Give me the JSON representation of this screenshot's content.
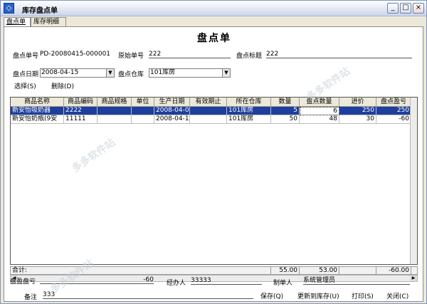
{
  "window": {
    "title": "库存盘点单",
    "icon_label": "◇"
  },
  "tabs": [
    "盘点单",
    "库存明细"
  ],
  "form": {
    "heading": "盘点单",
    "bill_no_label": "盘点单号",
    "bill_no": "PD-20080415-000001",
    "orig_no_label": "原始单号",
    "orig_no": "222",
    "title_label": "盘点标题",
    "title_value": "222",
    "date_label": "盘点日期",
    "date_value": "2008-04-15",
    "warehouse_label": "盘点仓库",
    "warehouse_value": "101库房",
    "select_label": "选择(S)",
    "delete_label": "删除(D)"
  },
  "table": {
    "headers": [
      "商品名称",
      "商品编码",
      "商品规格",
      "单位",
      "生产日期",
      "有效期止",
      "所在仓库",
      "数量",
      "盘点数量",
      "进价",
      "盘点盈亏"
    ],
    "rows": [
      [
        "新安怡吸奶器",
        "2222",
        "",
        "",
        "2008-04-08",
        "",
        "101库房",
        "5",
        "6",
        "250",
        "250"
      ],
      [
        "新安怡奶瓶(9安",
        "11111",
        "",
        "",
        "2008-04-13",
        "",
        "101库房",
        "50",
        "48",
        "30",
        "-60"
      ]
    ],
    "selected_row": 0
  },
  "totals": {
    "label": "合计:",
    "qty": "55.00",
    "count_qty": "53.00",
    "profit": "-60.00"
  },
  "footer": {
    "profit_label": "盘盈盘亏",
    "profit_value": "-60",
    "handler_label": "经办人",
    "handler_value": "33333",
    "maker_label": "制单人",
    "maker_value": "系统管理员",
    "remark_label": "备注",
    "remark_value": "333"
  },
  "buttons": {
    "save": "保存(Q)",
    "update": "更新到库存(U)",
    "print": "打印(S)",
    "close": "关闭(C)"
  },
  "window_buttons": {
    "min": "_",
    "max": "□",
    "close": "×"
  },
  "watermark": "多多软件站"
}
